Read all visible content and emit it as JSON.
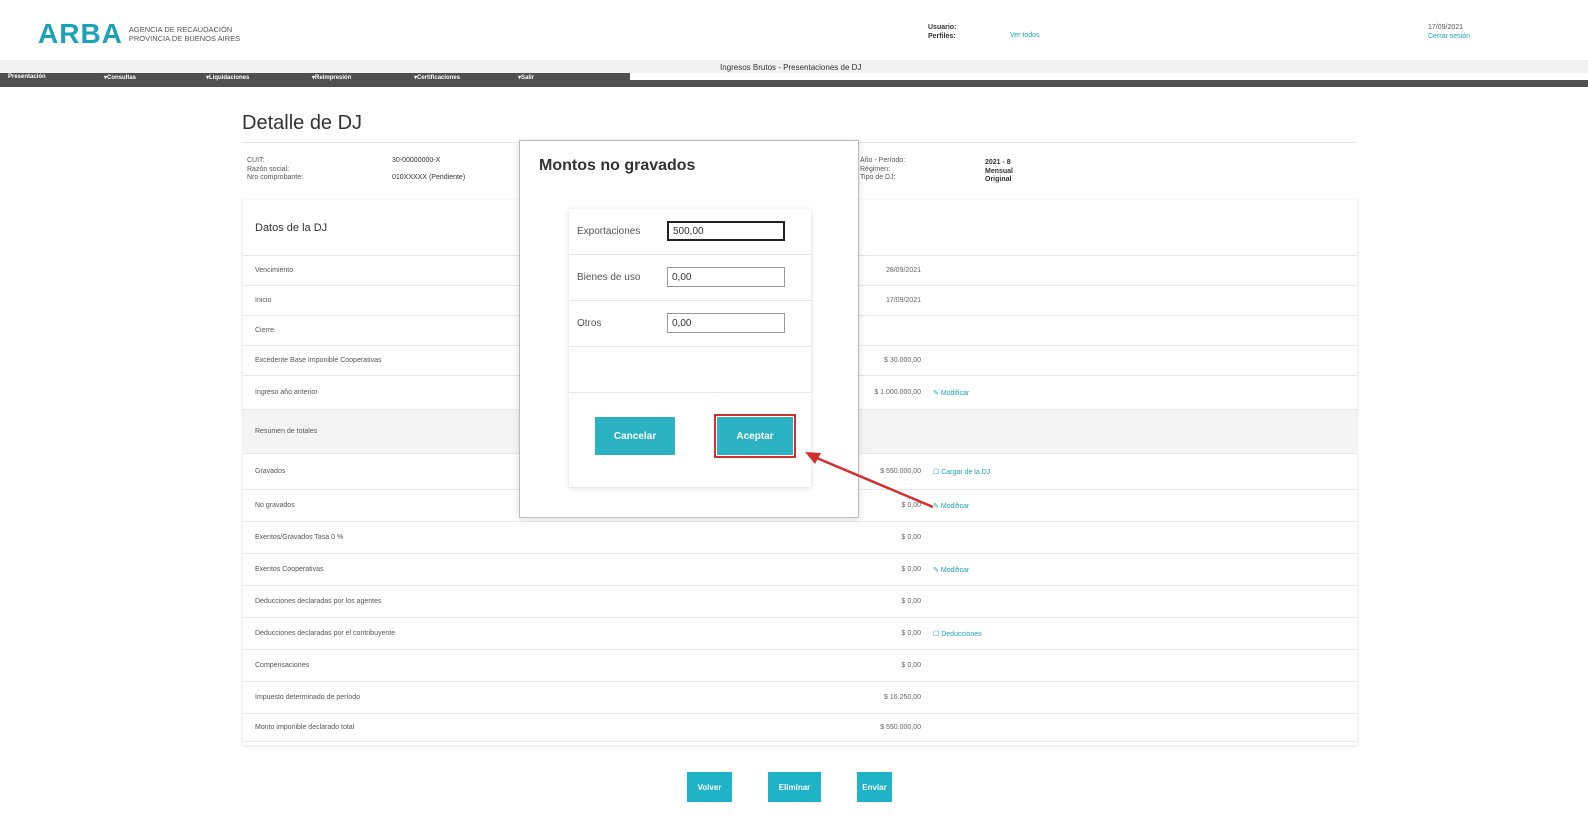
{
  "header": {
    "logo_text": "ARBA",
    "logo_sub_1": "AGENCIA DE RECAUDACIÓN",
    "logo_sub_2": "PROVINCIA DE BUENOS AIRES",
    "user_label": "Usuario:",
    "profiles_label": "Perfiles:",
    "view_users_link": "Ver todos",
    "date": "17/09/2021",
    "logout": "Cerrar sesión"
  },
  "menu": {
    "items": [
      "Presentación",
      "Consultas",
      "Liquidaciones",
      "Reimpresión",
      "Certificaciones",
      "Salir"
    ],
    "module_title": "Ingresos Brutos - Presentaciones de DJ"
  },
  "page": {
    "title": "Detalle de DJ",
    "left_info": {
      "labels": [
        "CUIT:",
        "Razón social:",
        "Nro comprobante:"
      ],
      "values": [
        "30-00000000-X",
        "",
        "010XXXXX (Pendiente)"
      ]
    },
    "right_info": {
      "labels": [
        "Año - Período:",
        "Régimen:",
        "Tipo de DJ:"
      ],
      "values": [
        "2021 - 8",
        "Mensual",
        "Original"
      ]
    },
    "panel_title": "Datos de la DJ",
    "rows": [
      {
        "label": "Vencimiento",
        "amount": "28/09/2021",
        "action": ""
      },
      {
        "label": "Inicio",
        "amount": "17/09/2021",
        "action": ""
      },
      {
        "label": "Cierre",
        "amount": "",
        "action": ""
      },
      {
        "label": "Excedente Base Imponible Cooperativas",
        "amount": "$ 30.000,00",
        "action": ""
      },
      {
        "label": "Ingreso año anterior",
        "amount": "$ 1.000.000,00",
        "action": "Modificar"
      },
      {
        "label": "Resumen de totales",
        "amount": "",
        "action": ""
      },
      {
        "label": "Gravados",
        "amount": "$ 550.000,00",
        "action": "Cargar de la DJ"
      },
      {
        "label": "No gravados",
        "amount": "$ 0,00",
        "action": "Modificar"
      },
      {
        "label": "Exentos/Gravados Tasa 0 %",
        "amount": "$ 0,00",
        "action": ""
      },
      {
        "label": "Exentos Cooperativas",
        "amount": "$ 0,00",
        "action": "Modificar"
      },
      {
        "label": "Deducciones declaradas por los agentes",
        "amount": "$ 0,00",
        "action": ""
      },
      {
        "label": "Deducciones declaradas por el contribuyente",
        "amount": "$ 0,00",
        "action": "Deducciones"
      },
      {
        "label": "Compensaciones",
        "amount": "$ 0,00",
        "action": ""
      },
      {
        "label": "Impuesto determinado de período",
        "amount": "$ 16.250,00",
        "action": ""
      },
      {
        "label": "Monto imponible declarado total",
        "amount": "$ 550.000,00",
        "action": ""
      }
    ],
    "buttons": {
      "back": "Volver",
      "delete": "Eliminar",
      "send": "Enviar"
    }
  },
  "modal": {
    "title": "Montos no gravados",
    "fields": [
      {
        "label": "Exportaciones",
        "value": "500,00"
      },
      {
        "label": "Bienes de uso",
        "value": "0,00"
      },
      {
        "label": "Otros",
        "value": "0,00"
      }
    ],
    "cancel": "Cancelar",
    "accept": "Aceptar"
  },
  "colors": {
    "accent": "#1fb3c8",
    "menubar": "#4f4f4f",
    "highlight": "#d32f2f"
  }
}
